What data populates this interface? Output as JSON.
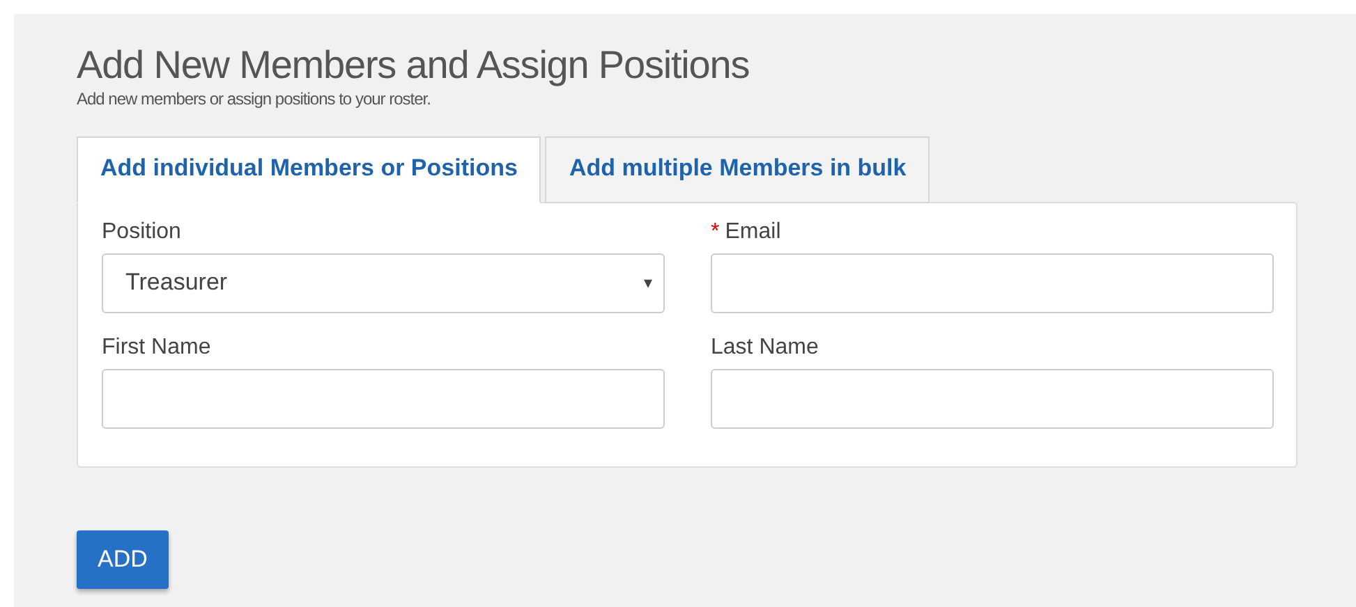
{
  "header": {
    "title": "Add New Members and Assign Positions",
    "subtitle": "Add new members or assign positions to your roster."
  },
  "tabs": [
    {
      "label": "Add individual Members or Positions",
      "selected": true
    },
    {
      "label": "Add multiple Members in bulk",
      "selected": false
    }
  ],
  "fields": [
    {
      "label": "Position",
      "kind": "select",
      "value": "Treasurer",
      "dropdown_icon": "▾"
    },
    {
      "label": "Email",
      "kind": "text",
      "required_mark": "*"
    },
    {
      "label": "First Name",
      "kind": "text"
    },
    {
      "label": "Last Name",
      "kind": "text"
    }
  ],
  "button": {
    "label": "ADD"
  }
}
